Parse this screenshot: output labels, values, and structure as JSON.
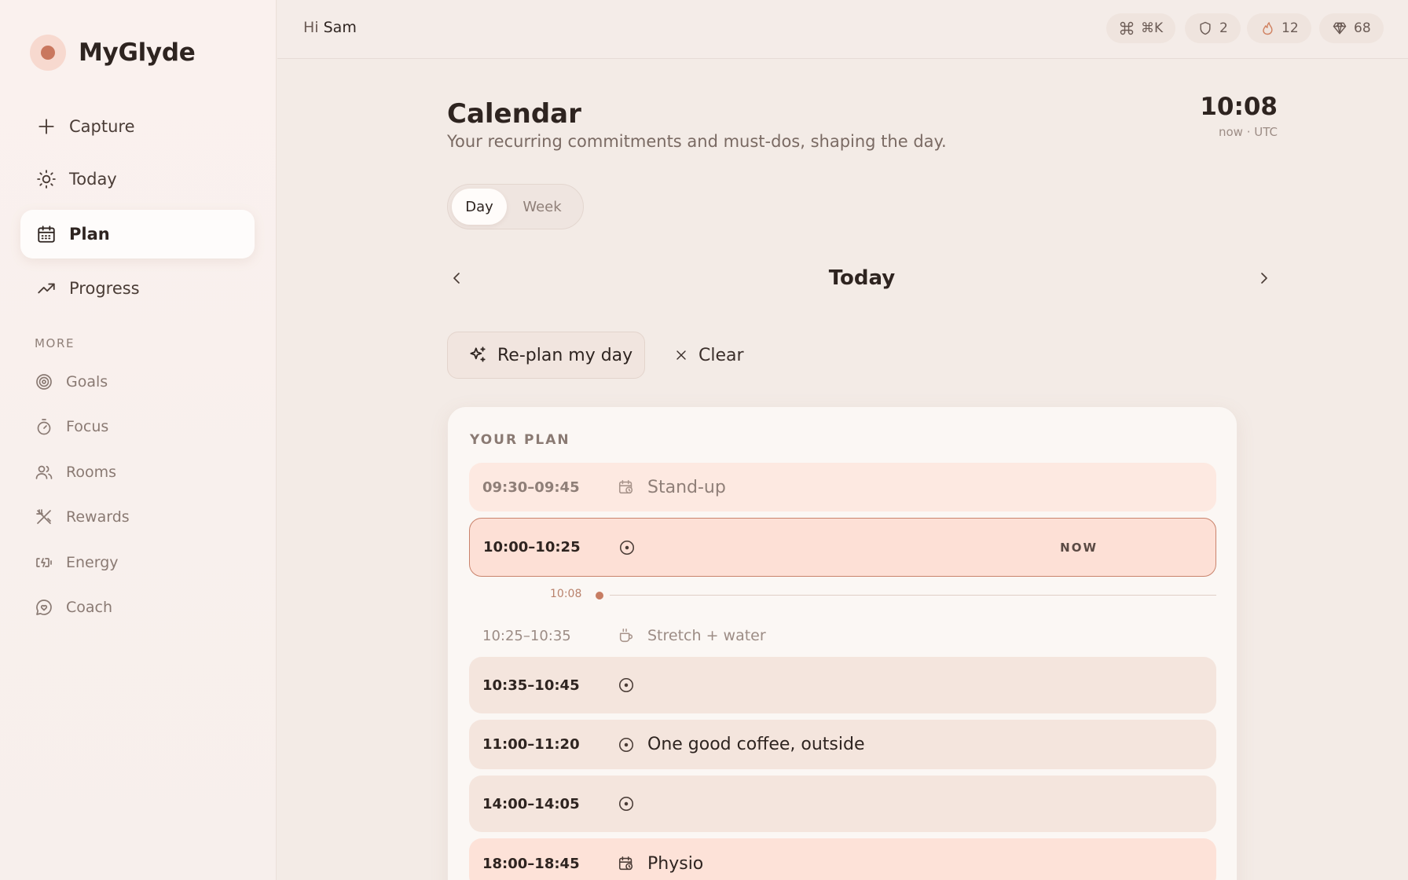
{
  "app": {
    "name": "MyGlyde"
  },
  "nav": {
    "primary": [
      {
        "label": "Capture",
        "icon": "plus-icon"
      },
      {
        "label": "Today",
        "icon": "sun-icon"
      },
      {
        "label": "Plan",
        "icon": "calendar-icon",
        "active": true
      },
      {
        "label": "Progress",
        "icon": "trending-up-icon"
      }
    ],
    "more_label": "MORE",
    "secondary": [
      {
        "label": "Goals",
        "icon": "target-icon"
      },
      {
        "label": "Focus",
        "icon": "timer-icon"
      },
      {
        "label": "Rooms",
        "icon": "users-icon"
      },
      {
        "label": "Rewards",
        "icon": "utensils-icon"
      },
      {
        "label": "Energy",
        "icon": "battery-charging-icon"
      },
      {
        "label": "Coach",
        "icon": "chat-heart-icon"
      }
    ]
  },
  "topbar": {
    "greeting_prefix": "Hi",
    "user_name": "Sam",
    "shortcut": "⌘K",
    "shields": "2",
    "streak": "12",
    "gems": "68"
  },
  "page": {
    "title": "Calendar",
    "subtitle": "Your recurring commitments and must-dos, shaping the day.",
    "clock": "10:08",
    "clock_sub": "now · UTC",
    "view_toggle": {
      "day": "Day",
      "week": "Week",
      "selected": "Day"
    },
    "day_label": "Today",
    "replan_label": "Re-plan my day",
    "clear_label": "Clear"
  },
  "plan": {
    "label": "YOUR PLAN",
    "now_marker": "10:08",
    "now_badge": "NOW",
    "items": [
      {
        "time": "09:30–09:45",
        "title": "Stand-up",
        "icon": "calendar-clock-icon",
        "style": "faded"
      },
      {
        "time": "10:00–10:25",
        "title": "",
        "icon": "target-dot-icon",
        "style": "current"
      },
      {
        "time": "10:25–10:35",
        "title": "Stretch + water",
        "icon": "coffee-icon",
        "style": "plain"
      },
      {
        "time": "10:35–10:45",
        "title": "",
        "icon": "target-dot-icon",
        "style": "task"
      },
      {
        "time": "11:00–11:20",
        "title": "One good coffee, outside",
        "icon": "target-dot-icon",
        "style": "task"
      },
      {
        "time": "14:00–14:05",
        "title": "",
        "icon": "target-dot-icon",
        "style": "task"
      },
      {
        "time": "18:00–18:45",
        "title": "Physio",
        "icon": "calendar-clock-icon",
        "style": "event"
      }
    ]
  },
  "colors": {
    "accent": "#c9775e",
    "current_row_bg": "#fde0d6",
    "current_row_border": "#c9836c",
    "task_row_bg": "#f4e5dd",
    "event_row_bg": "#fde2d8"
  }
}
